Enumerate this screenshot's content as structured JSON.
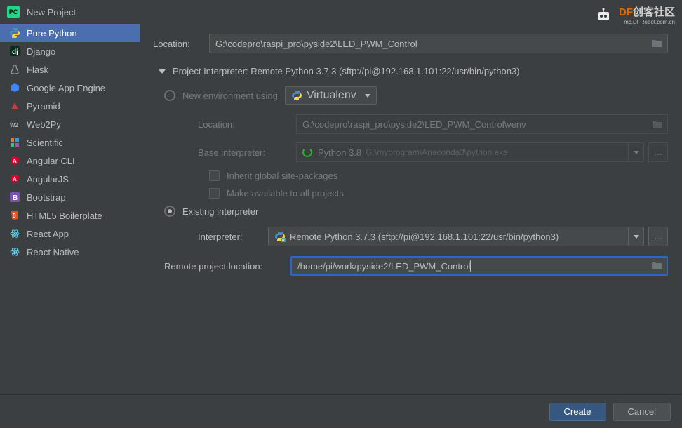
{
  "window": {
    "title": "New Project"
  },
  "sidebar": {
    "items": [
      {
        "label": "Pure Python"
      },
      {
        "label": "Django"
      },
      {
        "label": "Flask"
      },
      {
        "label": "Google App Engine"
      },
      {
        "label": "Pyramid"
      },
      {
        "label": "Web2Py"
      },
      {
        "label": "Scientific"
      },
      {
        "label": "Angular CLI"
      },
      {
        "label": "AngularJS"
      },
      {
        "label": "Bootstrap"
      },
      {
        "label": "HTML5 Boilerplate"
      },
      {
        "label": "React App"
      },
      {
        "label": "React Native"
      }
    ],
    "selected_index": 0
  },
  "form": {
    "location_label": "Location:",
    "location_value": "G:\\codepro\\raspi_pro\\pyside2\\LED_PWM_Control",
    "interpreter_section": "Project Interpreter: Remote Python 3.7.3 (sftp://pi@192.168.1.101:22/usr/bin/python3)",
    "new_env_label": "New environment using",
    "venv_option": "Virtualenv",
    "env_location_label": "Location:",
    "env_location_value": "G:\\codepro\\raspi_pro\\pyside2\\LED_PWM_Control\\venv",
    "base_interp_label": "Base interpreter:",
    "base_interp_value": "Python 3.8",
    "base_interp_path": "G:\\myprogram\\Anaconda3\\python.exe",
    "inherit_label": "Inherit global site-packages",
    "make_avail_label": "Make available to all projects",
    "existing_label": "Existing interpreter",
    "existing_interp_label": "Interpreter:",
    "existing_interp_value": "Remote Python 3.7.3 (sftp://pi@192.168.1.101:22/usr/bin/python3)",
    "remote_loc_label": "Remote project location:",
    "remote_loc_value": "/home/pi/work/pyside2/LED_PWM_Control"
  },
  "footer": {
    "create": "Create",
    "cancel": "Cancel"
  },
  "watermark": {
    "text": "DF创客社区",
    "sub": "mc.DFRobot.com.cn"
  },
  "colors": {
    "selection": "#4b6eaf",
    "focus_border": "#2f65ca",
    "primary_btn": "#365880"
  }
}
